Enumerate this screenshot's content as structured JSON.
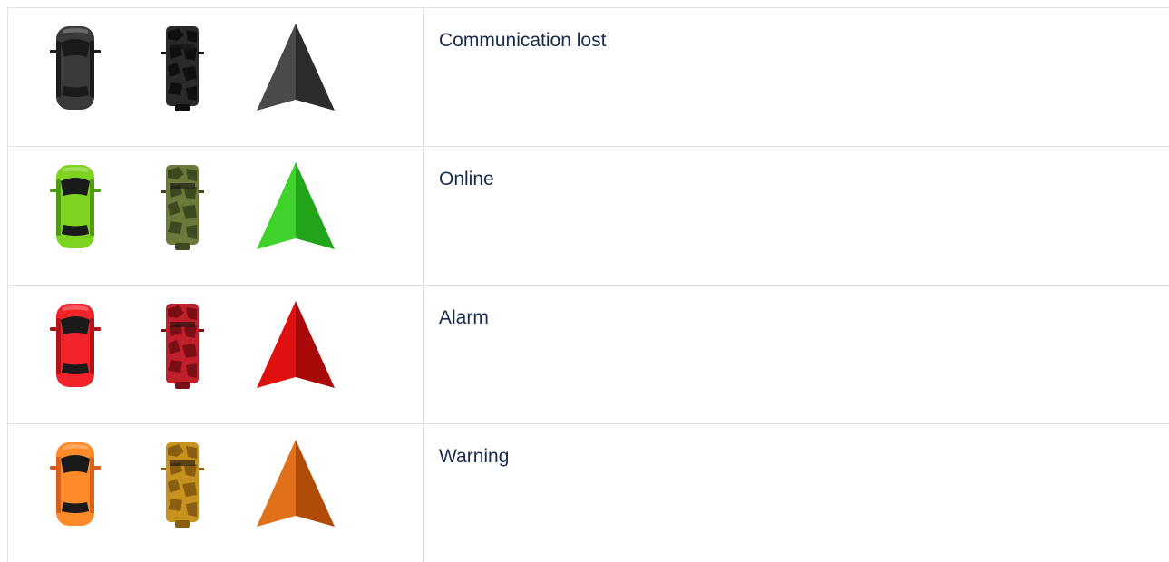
{
  "rows": [
    {
      "label": "Communication lost",
      "car_color": "#3a3a3a",
      "car_shade": "#1c1c1c",
      "truck_color": "#2a2a2a",
      "truck_camo": "#0f0f0f",
      "arrow_light": "#4a4a4a",
      "arrow_dark": "#2c2c2c"
    },
    {
      "label": "Online",
      "car_color": "#7ed321",
      "car_shade": "#4e9a10",
      "truck_color": "#6b7a3a",
      "truck_camo": "#3d4a1f",
      "arrow_light": "#3fd22a",
      "arrow_dark": "#22a51a"
    },
    {
      "label": "Alarm",
      "car_color": "#f2232a",
      "car_shade": "#b0141a",
      "truck_color": "#c0202a",
      "truck_camo": "#7a1015",
      "arrow_light": "#e01010",
      "arrow_dark": "#a80a0a"
    },
    {
      "label": "Warning",
      "car_color": "#ff8a2a",
      "car_shade": "#d9601a",
      "truck_color": "#c8921e",
      "truck_camo": "#8a5e10",
      "arrow_light": "#e0701a",
      "arrow_dark": "#b04c08"
    }
  ]
}
